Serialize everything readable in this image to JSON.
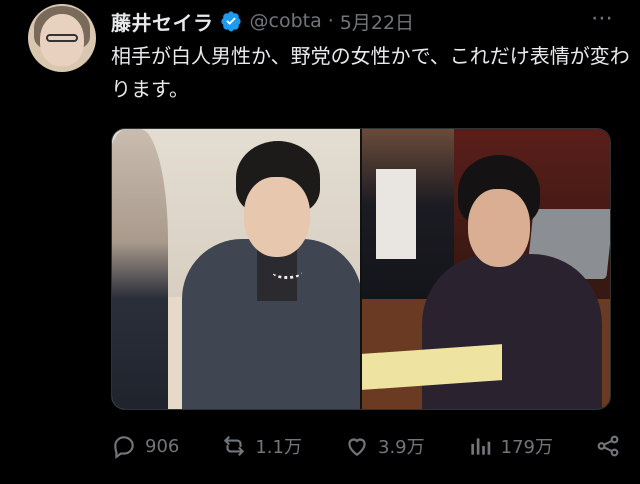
{
  "tweet": {
    "display_name": "藤井セイラ",
    "handle": "@cobta",
    "separator": "·",
    "date": "5月22日",
    "more_glyph": "⋯",
    "text": "相手が白人男性か、野党の女性かで、これだけ表情が変わります。"
  },
  "actions": {
    "reply_count": "906",
    "retweet_count": "1.1万",
    "like_count": "3.9万",
    "views_count": "179万"
  },
  "icons": {
    "verified": "verified-badge-icon",
    "reply": "reply-icon",
    "retweet": "retweet-icon",
    "like": "heart-icon",
    "views": "views-icon",
    "share": "share-icon",
    "more": "more-icon"
  },
  "colors": {
    "background": "#000000",
    "text": "#e7e9ea",
    "secondary": "#71767b",
    "verified": "#1d9bf0"
  }
}
